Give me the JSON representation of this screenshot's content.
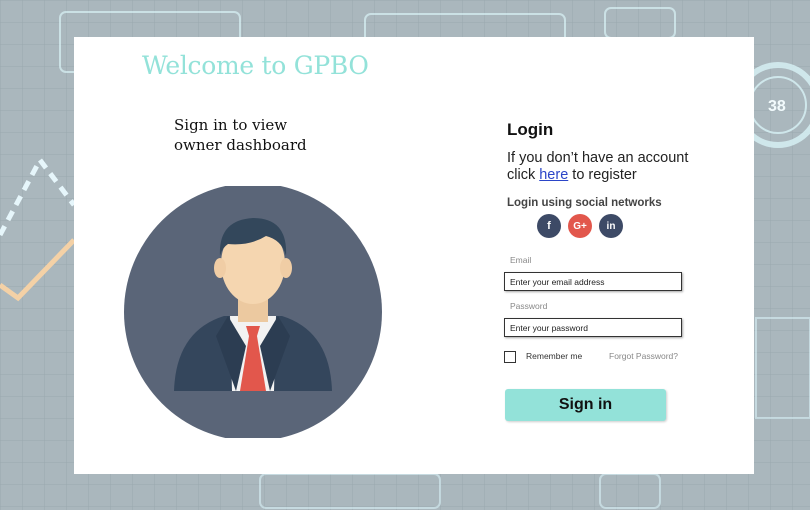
{
  "welcome_title": "Welcome to GPBO",
  "subtitle": "Sign in to view owner dashboard",
  "login": {
    "title": "Login",
    "note_before": "If you don’t have an account click ",
    "note_link": "here",
    "note_after": " to register",
    "social_label": "Login using social networks",
    "social": {
      "facebook": "f",
      "google": "G+",
      "linkedin": "in"
    },
    "email_label": "Email",
    "email_placeholder": "Enter your email address",
    "password_label": "Password",
    "password_placeholder": "Enter your password",
    "remember_label": "Remember me",
    "forgot_label": "Forgot Password?",
    "signin_label": "Sign in"
  },
  "background": {
    "gauge_value": "38"
  },
  "colors": {
    "accent": "#93e2d9",
    "link": "#2b45c8",
    "avatar_bg": "#5a6578",
    "tie": "#e2574c",
    "suit": "#34465c",
    "skin": "#f5d6b0",
    "hair": "#33475b"
  }
}
